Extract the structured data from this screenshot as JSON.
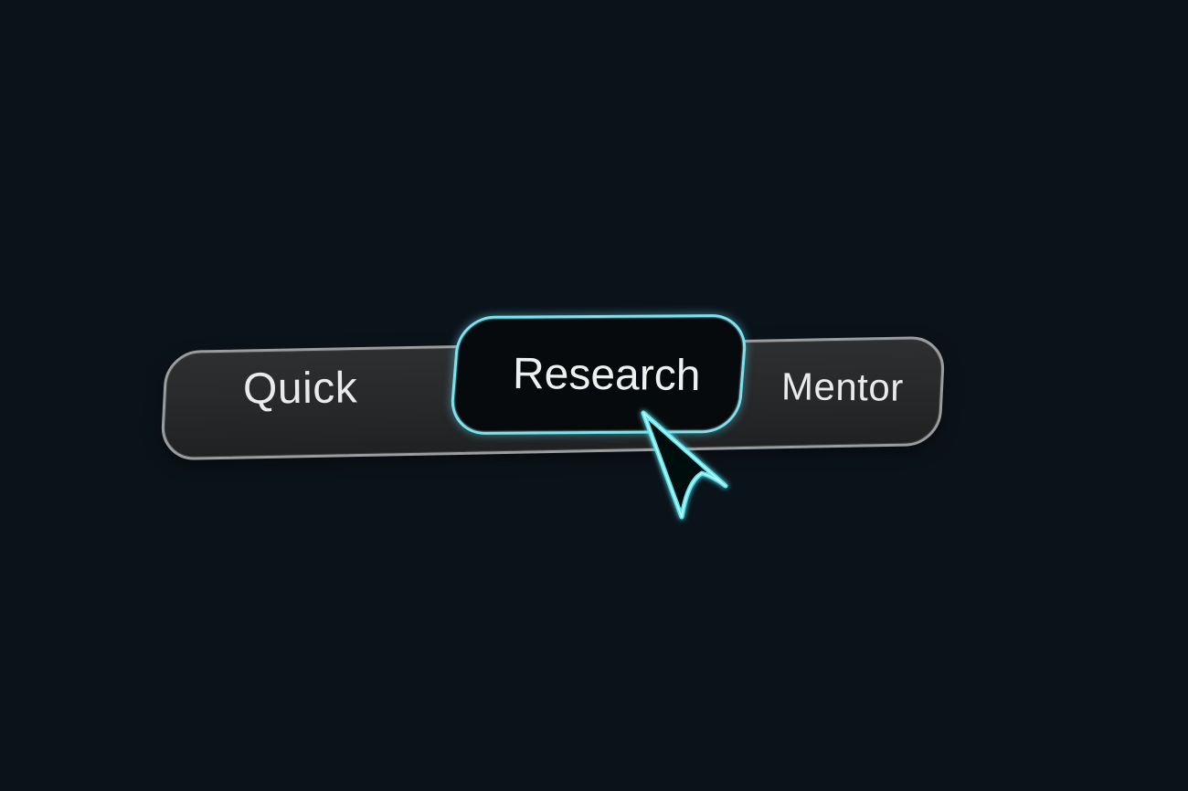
{
  "segmented_control": {
    "options": [
      {
        "label": "Quick"
      },
      {
        "label": "Research"
      },
      {
        "label": "Mentor"
      }
    ],
    "selected_label": "Research"
  },
  "colors": {
    "background": "#0b131a",
    "track": "#2a2c2e",
    "track_border": "#9b9c9e",
    "selected_fill": "#060a0d",
    "accent": "#7ee2ee",
    "text": "#e9eaea"
  },
  "cursor": {
    "icon": "arrow-pointer-icon",
    "style": "neon outline"
  }
}
